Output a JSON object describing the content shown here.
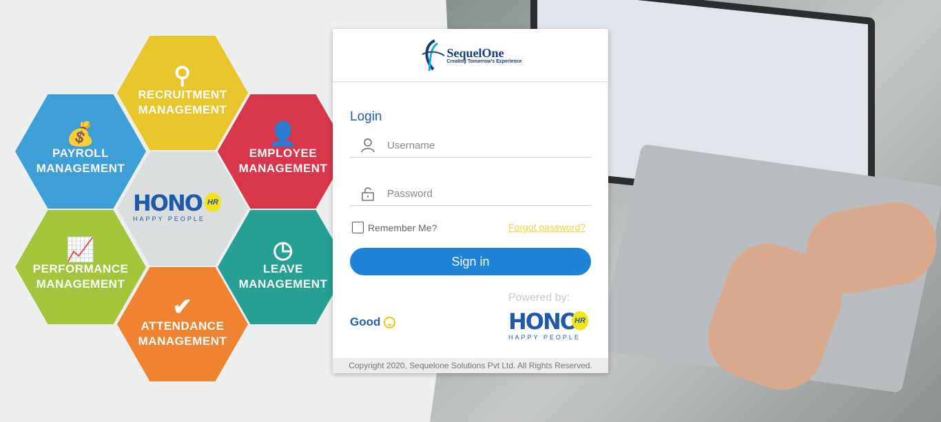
{
  "brand": {
    "name": "SequelOne",
    "tagline": "Creating Tomorrow's Experience"
  },
  "background_hexes": [
    {
      "label": "RECRUITMENT\nMANAGEMENT",
      "color": "#e8c21a",
      "icon": "search-person-icon"
    },
    {
      "label": "PAYROLL\nMANAGEMENT",
      "color": "#2e97d6",
      "icon": "money-bag-icon"
    },
    {
      "label": "EMPLOYEE\nMANAGEMENT",
      "color": "#d6263c",
      "icon": "employee-icon"
    },
    {
      "label": "PERFORMANCE\nMANAGEMENT",
      "color": "#9ec22c",
      "icon": "growth-chart-icon"
    },
    {
      "label": "LEAVE\nMANAGEMENT",
      "color": "#159a8a",
      "icon": "clock-icon"
    },
    {
      "label": "ATTENDANCE\nMANAGEMENT",
      "color": "#ef7a22",
      "icon": "attendance-check-icon"
    }
  ],
  "login": {
    "title": "Login",
    "username_placeholder": "Username",
    "password_placeholder": "Password",
    "remember_label": "Remember Me?",
    "forgot_label": "Forgot password?",
    "signin_label": "Sign in",
    "powered_by": "Powered by:",
    "mood_text": "Good"
  },
  "hono": {
    "word": "HONO",
    "badge": "HR",
    "sub": "HAPPY PEOPLE"
  },
  "footer": {
    "copyright": "Copyright 2020, Sequelone Solutions Pvt Ltd. All Rights Reserved."
  },
  "colors": {
    "primary": "#1f83d8",
    "heading": "#1f5fa8",
    "forgot_link": "#f4d53a",
    "smiley": "#f2c400"
  }
}
